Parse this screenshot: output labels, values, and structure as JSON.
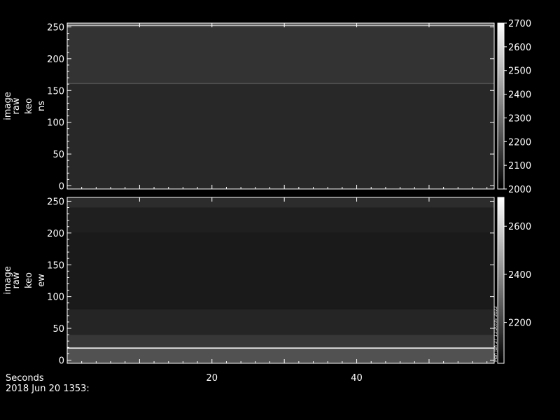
{
  "chart_data": [
    {
      "type": "heatmap",
      "title": "",
      "ylabel": [
        "image",
        "raw",
        "keo",
        "ns"
      ],
      "xlabel": "",
      "xlim": [
        0,
        59
      ],
      "ylim": [
        -5,
        256
      ],
      "xticks": [
        20,
        40
      ],
      "yticks": [
        0,
        50,
        100,
        150,
        200,
        250
      ],
      "colorbar": {
        "range": [
          2000,
          2700
        ],
        "ticks": [
          2000,
          2100,
          2200,
          2300,
          2400,
          2500,
          2600,
          2700
        ]
      },
      "rows": [
        {
          "y0": -5,
          "y1": 160,
          "value": 2110
        },
        {
          "y0": 160,
          "y1": 162,
          "value": 2220
        },
        {
          "y0": 162,
          "y1": 250,
          "value": 2140
        },
        {
          "y0": 250,
          "y1": 252,
          "value": 2230
        },
        {
          "y0": 252,
          "y1": 253,
          "value": 2700
        },
        {
          "y0": 253,
          "y1": 256,
          "value": 2250
        }
      ]
    },
    {
      "type": "heatmap",
      "title": "",
      "ylabel": [
        "image",
        "raw",
        "keo",
        "ew"
      ],
      "xlabel": "Seconds",
      "xlim": [
        0,
        59
      ],
      "ylim": [
        -5,
        256
      ],
      "xticks": [
        20,
        40
      ],
      "yticks": [
        0,
        50,
        100,
        150,
        200,
        250
      ],
      "colorbar": {
        "range": [
          2030,
          2720
        ],
        "ticks": [
          2200,
          2400,
          2600
        ],
        "side_label": "Mon Jun 27 11:20:05 2022"
      },
      "rows": [
        {
          "y0": -5,
          "y1": 18,
          "value": 2250
        },
        {
          "y0": 18,
          "y1": 20,
          "value": 2720
        },
        {
          "y0": 20,
          "y1": 40,
          "value": 2180
        },
        {
          "y0": 40,
          "y1": 80,
          "value": 2130
        },
        {
          "y0": 80,
          "y1": 200,
          "value": 2100
        },
        {
          "y0": 200,
          "y1": 240,
          "value": 2115
        },
        {
          "y0": 240,
          "y1": 256,
          "value": 2150
        }
      ]
    }
  ],
  "footer": {
    "xaxis_label": "Seconds",
    "date": "2018 Jun 20 1353:"
  }
}
